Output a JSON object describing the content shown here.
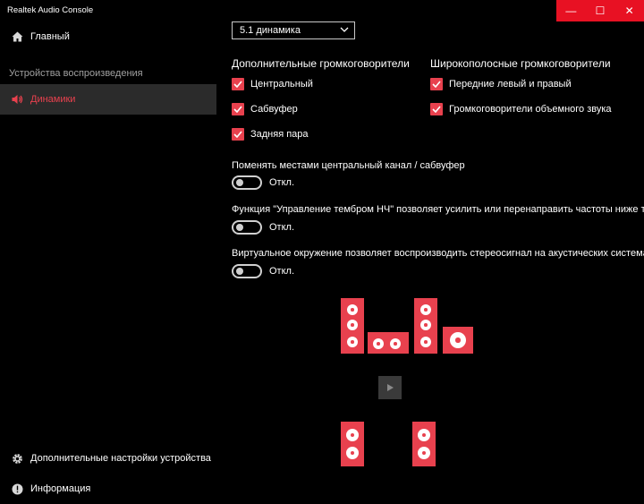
{
  "window": {
    "title": "Realtek Audio Console",
    "minimize_glyph": "—",
    "maximize_glyph": "☐",
    "close_glyph": "✕"
  },
  "sidebar": {
    "home_label": "Главный",
    "section_label": "Устройства воспроизведения",
    "speakers_label": "Динамики",
    "advanced_label": "Дополнительные настройки устройства",
    "info_label": "Информация"
  },
  "main": {
    "config_select": "5.1 динамика",
    "optional_speakers": {
      "heading": "Дополнительные громкоговорители",
      "items": [
        {
          "label": "Центральный",
          "checked": true
        },
        {
          "label": "Сабвуфер",
          "checked": true
        },
        {
          "label": "Задняя пара",
          "checked": true
        }
      ]
    },
    "fullrange_speakers": {
      "heading": "Широкополосные громкоговорители",
      "items": [
        {
          "label": "Передние левый и правый",
          "checked": true
        },
        {
          "label": "Громкоговорители объемного звука",
          "checked": true
        }
      ]
    },
    "options": [
      {
        "text": "Поменять местами центральный канал / сабвуфер",
        "state": "Откл."
      },
      {
        "text": "Функция \"Управление тембром НЧ\" позволяет усилить или перенаправить частоты ниже точки",
        "state": "Откл."
      },
      {
        "text": "Виртуальное окружение позволяет воспроизводить стереосигнал на акустических системах об",
        "state": "Откл."
      }
    ]
  },
  "colors": {
    "accent": "#e8414e",
    "titlebar_buttons": "#e81123",
    "background": "#000000"
  }
}
